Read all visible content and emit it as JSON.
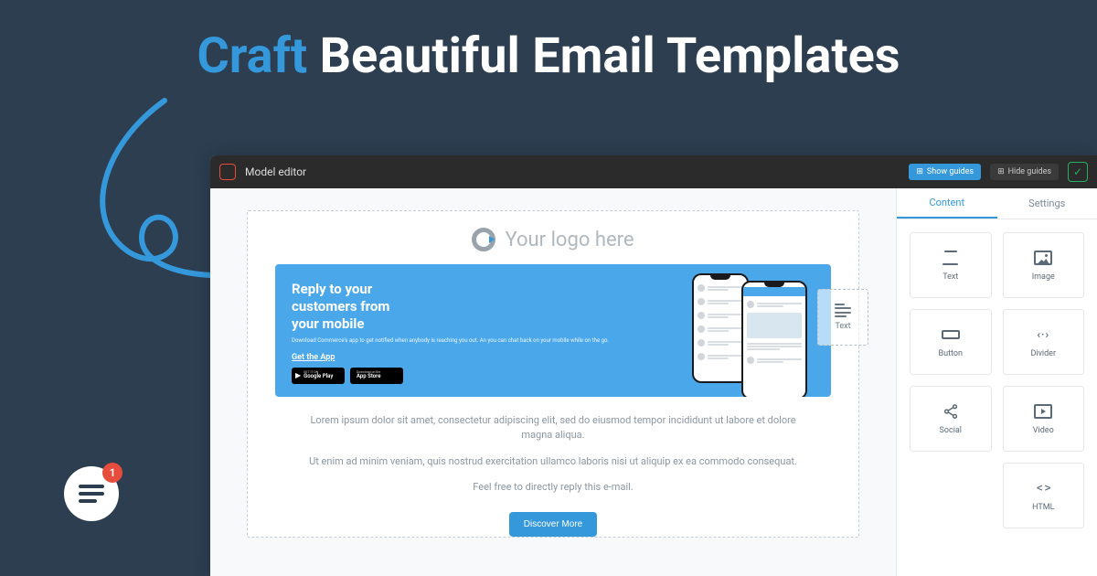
{
  "hero": {
    "accent_word": "Craft",
    "rest": "Beautiful Email Templates"
  },
  "chat": {
    "badge_count": "1"
  },
  "app": {
    "title": "Model editor",
    "show_guides": "Show guides",
    "hide_guides": "Hide guides"
  },
  "sidebar": {
    "tabs": {
      "content": "Content",
      "settings": "Settings"
    },
    "blocks": {
      "text": "Text",
      "image": "Image",
      "button": "Button",
      "divider": "Divider",
      "social": "Social",
      "video": "Video",
      "html": "HTML"
    }
  },
  "canvas": {
    "logo_placeholder": "Your logo here",
    "drop_label": "Text",
    "hero_block": {
      "heading_l1": "Reply to your",
      "heading_l2": "customers from",
      "heading_l3": "your mobile",
      "desc": "Download Commerce's app to get notified when anybody is reaching you out. An you can chat back on your mobile while on the go.",
      "cta": "Get the App",
      "google_small": "GET IT ON",
      "google": "Google Play",
      "apple_small": "Download on the",
      "apple": "App Store"
    },
    "body": {
      "p1": "Lorem ipsum dolor sit amet, consectetur adipiscing elit, sed do eiusmod tempor incididunt ut labore et dolore magna aliqua.",
      "p2": "Ut enim ad minim veniam, quis nostrud exercitation ullamco laboris nisi ut aliquip ex ea commodo consequat.",
      "p3": "Feel free to directly reply this e-mail.",
      "button": "Discover More"
    }
  }
}
